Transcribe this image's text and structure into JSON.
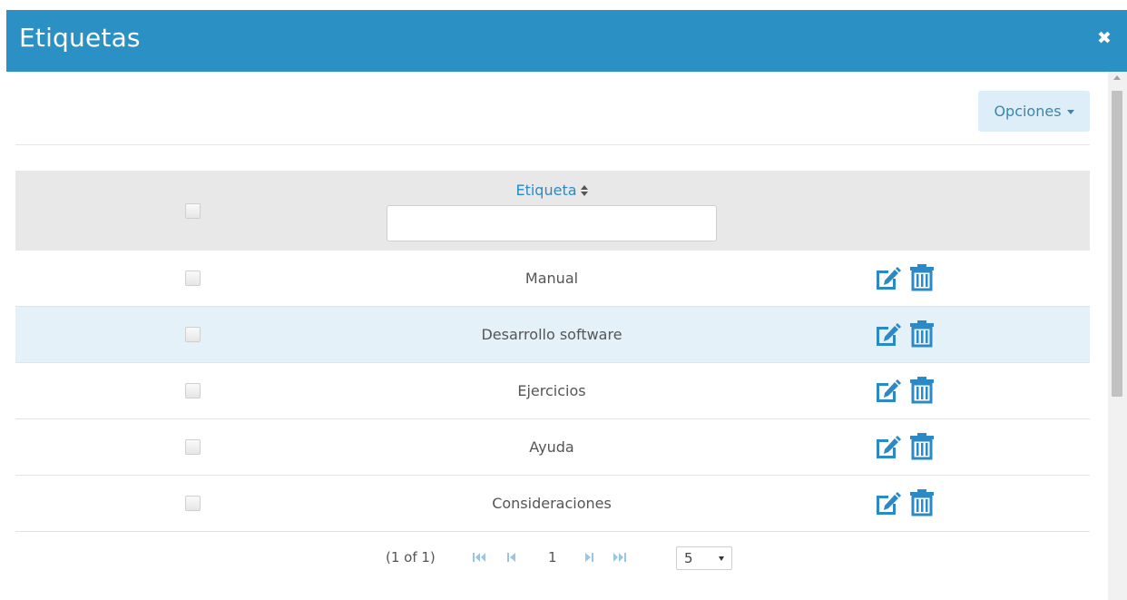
{
  "dialog": {
    "title": "Etiquetas",
    "close_glyph": "✖"
  },
  "toolbar": {
    "options_label": "Opciones"
  },
  "table": {
    "column_header": "Etiqueta",
    "rows": [
      {
        "label": "Manual",
        "highlighted": false
      },
      {
        "label": "Desarrollo software",
        "highlighted": true
      },
      {
        "label": "Ejercicios",
        "highlighted": false
      },
      {
        "label": "Ayuda",
        "highlighted": false
      },
      {
        "label": "Consideraciones",
        "highlighted": false
      }
    ],
    "row_actions": [
      "edit-icon",
      "trash-icon"
    ]
  },
  "paginator": {
    "page_report": "(1 of 1)",
    "current_page": "1",
    "rows_per_page": "5"
  },
  "colors": {
    "header": "#2b90c4",
    "accent": "#2b8ac6",
    "row_highlight": "#e5f1f9"
  }
}
